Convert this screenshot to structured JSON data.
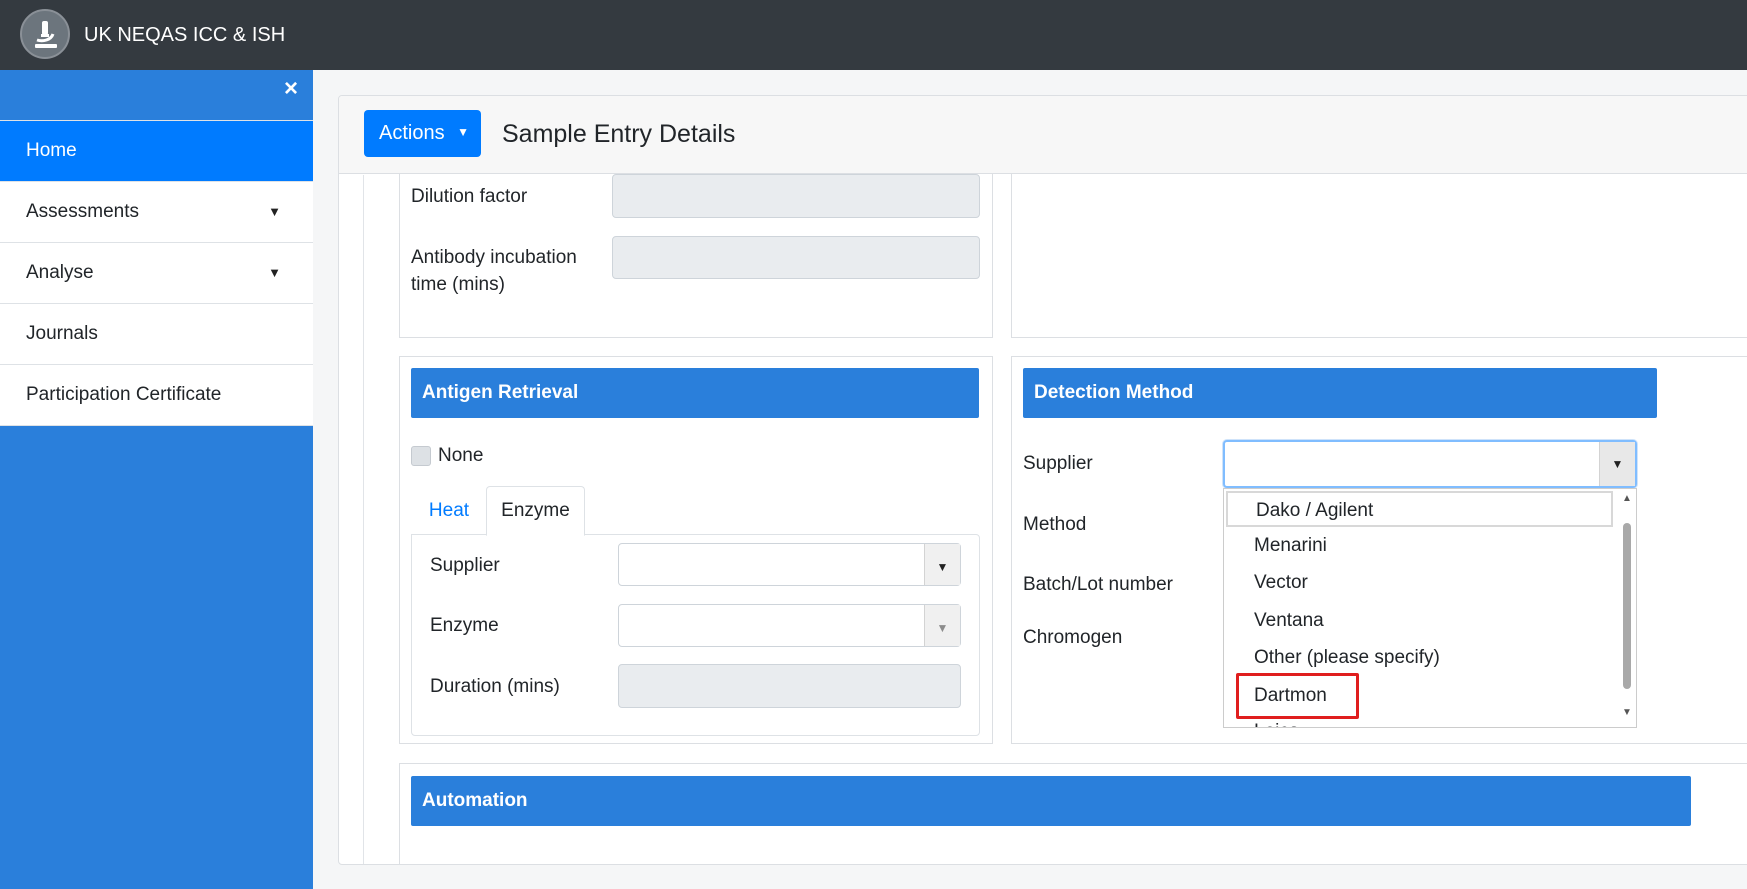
{
  "app": {
    "title": "UK NEQAS ICC & ISH"
  },
  "sidebar": {
    "close_icon": "×",
    "items": [
      {
        "label": "Home",
        "active": true
      },
      {
        "label": "Assessments",
        "has_caret": true
      },
      {
        "label": "Analyse",
        "has_caret": true
      },
      {
        "label": "Journals"
      },
      {
        "label": "Participation Certificate"
      }
    ],
    "caret_glyph": "▼"
  },
  "header": {
    "actions_label": "Actions",
    "actions_caret": "▼",
    "title": "Sample Entry Details"
  },
  "antibody_section": {
    "dilution_label": "Dilution factor",
    "incubation_label_line1": "Antibody incubation",
    "incubation_label_line2": "time (mins)"
  },
  "antigen_retrieval": {
    "heading": "Antigen Retrieval",
    "none_label": "None",
    "tabs": [
      {
        "label": "Heat",
        "active": false
      },
      {
        "label": "Enzyme",
        "active": true
      }
    ],
    "supplier_label": "Supplier",
    "enzyme_label": "Enzyme",
    "duration_label": "Duration (mins)"
  },
  "detection_method": {
    "heading": "Detection Method",
    "supplier_label": "Supplier",
    "method_label": "Method",
    "batch_label": "Batch/Lot number",
    "chromogen_label": "Chromogen",
    "supplier_value": "",
    "supplier_options": [
      "Dako / Agilent",
      "Menarini",
      "Vector",
      "Ventana",
      "Other (please specify)",
      "Dartmon",
      "Leica"
    ],
    "highlighted_option": "Dartmon"
  },
  "automation": {
    "heading": "Automation"
  },
  "colors": {
    "topbar": "#343a40",
    "sidebar": "#2a7fdb",
    "primary": "#007bff",
    "panel_header": "#2a7fdb",
    "highlight_box": "#e01e1e"
  }
}
